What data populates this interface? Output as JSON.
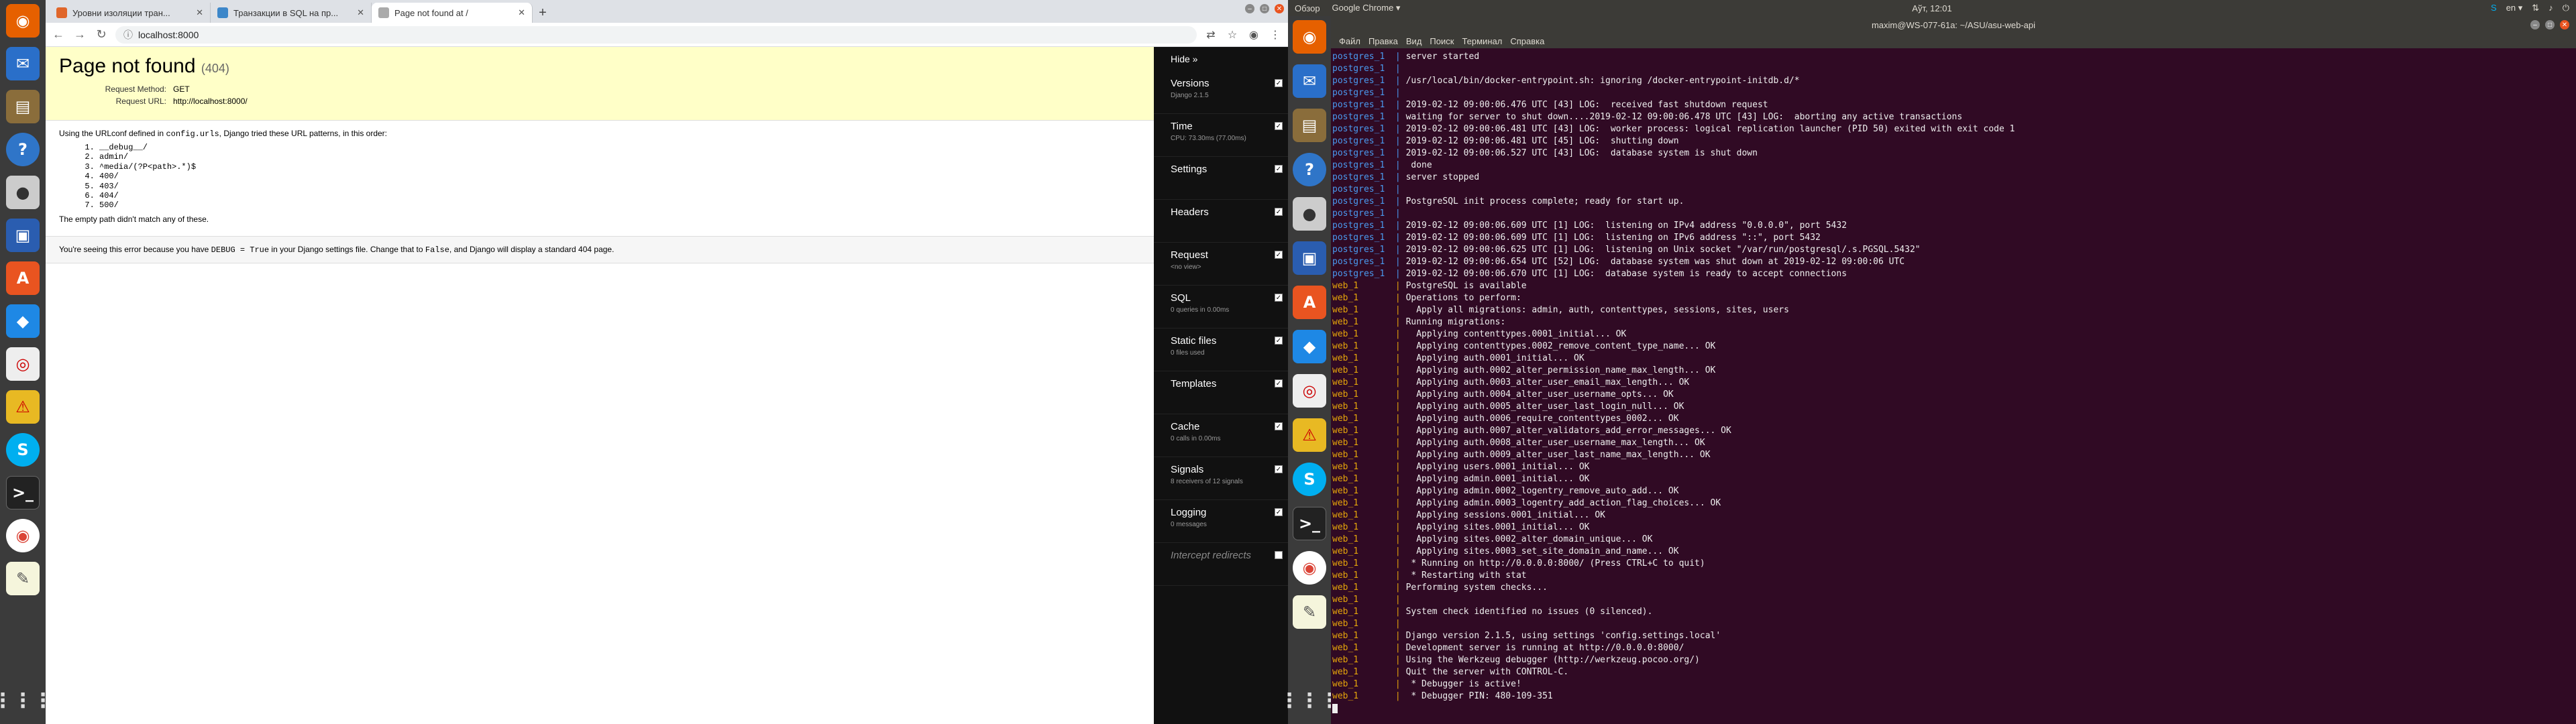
{
  "chrome": {
    "tabs": [
      {
        "label": "Уровни изоляции тран...",
        "active": false,
        "favicon_color": "#e0662a"
      },
      {
        "label": "Транзакции в SQL на пр...",
        "active": false,
        "favicon_color": "#3d87c9"
      },
      {
        "label": "Page not found at /",
        "active": true,
        "favicon_color": "#aaaaaa"
      }
    ],
    "new_tab_label": "+",
    "url": "localhost:8000"
  },
  "django": {
    "title": "Page not found",
    "code": "(404)",
    "meta": [
      {
        "key": "Request Method:",
        "value": "GET"
      },
      {
        "key": "Request URL:",
        "value": "http://localhost:8000/"
      }
    ],
    "info_lead_1": "Using the URLconf defined in ",
    "info_lead_code": "config.urls",
    "info_lead_2": ", Django tried these URL patterns, in this order:",
    "patterns": [
      "__debug__/",
      "admin/",
      "^media/(?P<path>.*)$",
      "400/",
      "403/",
      "404/",
      "500/"
    ],
    "info_tail": "The empty path didn't match any of these.",
    "explanation_1": "You're seeing this error because you have ",
    "explanation_code1": "DEBUG = True",
    "explanation_2": " in your Django settings file. Change that to ",
    "explanation_code2": "False",
    "explanation_3": ", and Django will display a standard 404 page."
  },
  "djdt": {
    "hide": "Hide »",
    "panels": [
      {
        "title": "Versions",
        "sub": "Django 2.1.5",
        "checked": true
      },
      {
        "title": "Time",
        "sub": "CPU: 73.30ms (77.00ms)",
        "checked": true
      },
      {
        "title": "Settings",
        "sub": "",
        "checked": true
      },
      {
        "title": "Headers",
        "sub": "",
        "checked": true
      },
      {
        "title": "Request",
        "sub": "<no view>",
        "checked": true
      },
      {
        "title": "SQL",
        "sub": "0 queries in 0.00ms",
        "checked": true
      },
      {
        "title": "Static files",
        "sub": "0 files used",
        "checked": true
      },
      {
        "title": "Templates",
        "sub": "",
        "checked": true
      },
      {
        "title": "Cache",
        "sub": "0 calls in 0.00ms",
        "checked": true
      },
      {
        "title": "Signals",
        "sub": "8 receivers of 12 signals",
        "checked": true
      },
      {
        "title": "Logging",
        "sub": "0 messages",
        "checked": true
      },
      {
        "title": "Intercept redirects",
        "sub": "",
        "checked": false
      }
    ]
  },
  "ubuntu": {
    "activities": "Обзор",
    "app_menu": "Google Chrome ▾",
    "clock": "Аўт, 12:01",
    "lang": "en ▾"
  },
  "terminal": {
    "title": "maxim@WS-077-61a: ~/ASU/asu-web-api",
    "menu": [
      "Файл",
      "Правка",
      "Вид",
      "Поиск",
      "Терминал",
      "Справка"
    ],
    "lines": [
      {
        "p": "postgres_1  | ",
        "t": "server started",
        "k": "pg"
      },
      {
        "p": "postgres_1  | ",
        "t": "",
        "k": "pg"
      },
      {
        "p": "postgres_1  | ",
        "t": "/usr/local/bin/docker-entrypoint.sh: ignoring /docker-entrypoint-initdb.d/*",
        "k": "pg"
      },
      {
        "p": "postgres_1  | ",
        "t": "",
        "k": "pg"
      },
      {
        "p": "postgres_1  | ",
        "t": "2019-02-12 09:00:06.476 UTC [43] LOG:  received fast shutdown request",
        "k": "pg"
      },
      {
        "p": "postgres_1  | ",
        "t": "waiting for server to shut down....2019-02-12 09:00:06.478 UTC [43] LOG:  aborting any active transactions",
        "k": "pg"
      },
      {
        "p": "postgres_1  | ",
        "t": "2019-02-12 09:00:06.481 UTC [43] LOG:  worker process: logical replication launcher (PID 50) exited with exit code 1",
        "k": "pg"
      },
      {
        "p": "postgres_1  | ",
        "t": "2019-02-12 09:00:06.481 UTC [45] LOG:  shutting down",
        "k": "pg"
      },
      {
        "p": "postgres_1  | ",
        "t": "2019-02-12 09:00:06.527 UTC [43] LOG:  database system is shut down",
        "k": "pg"
      },
      {
        "p": "postgres_1  | ",
        "t": " done",
        "k": "pg"
      },
      {
        "p": "postgres_1  | ",
        "t": "server stopped",
        "k": "pg"
      },
      {
        "p": "postgres_1  | ",
        "t": "",
        "k": "pg"
      },
      {
        "p": "postgres_1  | ",
        "t": "PostgreSQL init process complete; ready for start up.",
        "k": "pg"
      },
      {
        "p": "postgres_1  | ",
        "t": "",
        "k": "pg"
      },
      {
        "p": "postgres_1  | ",
        "t": "2019-02-12 09:00:06.609 UTC [1] LOG:  listening on IPv4 address \"0.0.0.0\", port 5432",
        "k": "pg"
      },
      {
        "p": "postgres_1  | ",
        "t": "2019-02-12 09:00:06.609 UTC [1] LOG:  listening on IPv6 address \"::\", port 5432",
        "k": "pg"
      },
      {
        "p": "postgres_1  | ",
        "t": "2019-02-12 09:00:06.625 UTC [1] LOG:  listening on Unix socket \"/var/run/postgresql/.s.PGSQL.5432\"",
        "k": "pg"
      },
      {
        "p": "postgres_1  | ",
        "t": "2019-02-12 09:00:06.654 UTC [52] LOG:  database system was shut down at 2019-02-12 09:00:06 UTC",
        "k": "pg"
      },
      {
        "p": "postgres_1  | ",
        "t": "2019-02-12 09:00:06.670 UTC [1] LOG:  database system is ready to accept connections",
        "k": "pg"
      },
      {
        "p": "web_1       | ",
        "t": "PostgreSQL is available",
        "k": "web"
      },
      {
        "p": "web_1       | ",
        "t": "Operations to perform:",
        "k": "web"
      },
      {
        "p": "web_1       | ",
        "t": "  Apply all migrations: admin, auth, contenttypes, sessions, sites, users",
        "k": "web"
      },
      {
        "p": "web_1       | ",
        "t": "Running migrations:",
        "k": "web"
      },
      {
        "p": "web_1       | ",
        "t": "  Applying contenttypes.0001_initial... OK",
        "k": "web"
      },
      {
        "p": "web_1       | ",
        "t": "  Applying contenttypes.0002_remove_content_type_name... OK",
        "k": "web"
      },
      {
        "p": "web_1       | ",
        "t": "  Applying auth.0001_initial... OK",
        "k": "web"
      },
      {
        "p": "web_1       | ",
        "t": "  Applying auth.0002_alter_permission_name_max_length... OK",
        "k": "web"
      },
      {
        "p": "web_1       | ",
        "t": "  Applying auth.0003_alter_user_email_max_length... OK",
        "k": "web"
      },
      {
        "p": "web_1       | ",
        "t": "  Applying auth.0004_alter_user_username_opts... OK",
        "k": "web"
      },
      {
        "p": "web_1       | ",
        "t": "  Applying auth.0005_alter_user_last_login_null... OK",
        "k": "web"
      },
      {
        "p": "web_1       | ",
        "t": "  Applying auth.0006_require_contenttypes_0002... OK",
        "k": "web"
      },
      {
        "p": "web_1       | ",
        "t": "  Applying auth.0007_alter_validators_add_error_messages... OK",
        "k": "web"
      },
      {
        "p": "web_1       | ",
        "t": "  Applying auth.0008_alter_user_username_max_length... OK",
        "k": "web"
      },
      {
        "p": "web_1       | ",
        "t": "  Applying auth.0009_alter_user_last_name_max_length... OK",
        "k": "web"
      },
      {
        "p": "web_1       | ",
        "t": "  Applying users.0001_initial... OK",
        "k": "web"
      },
      {
        "p": "web_1       | ",
        "t": "  Applying admin.0001_initial... OK",
        "k": "web"
      },
      {
        "p": "web_1       | ",
        "t": "  Applying admin.0002_logentry_remove_auto_add... OK",
        "k": "web"
      },
      {
        "p": "web_1       | ",
        "t": "  Applying admin.0003_logentry_add_action_flag_choices... OK",
        "k": "web"
      },
      {
        "p": "web_1       | ",
        "t": "  Applying sessions.0001_initial... OK",
        "k": "web"
      },
      {
        "p": "web_1       | ",
        "t": "  Applying sites.0001_initial... OK",
        "k": "web"
      },
      {
        "p": "web_1       | ",
        "t": "  Applying sites.0002_alter_domain_unique... OK",
        "k": "web"
      },
      {
        "p": "web_1       | ",
        "t": "  Applying sites.0003_set_site_domain_and_name... OK",
        "k": "web"
      },
      {
        "p": "web_1       | ",
        "t": " * Running on http://0.0.0.0:8000/ (Press CTRL+C to quit)",
        "k": "web"
      },
      {
        "p": "web_1       | ",
        "t": " * Restarting with stat",
        "k": "web"
      },
      {
        "p": "web_1       | ",
        "t": "Performing system checks...",
        "k": "web"
      },
      {
        "p": "web_1       | ",
        "t": "",
        "k": "web"
      },
      {
        "p": "web_1       | ",
        "t": "System check identified no issues (0 silenced).",
        "k": "web"
      },
      {
        "p": "web_1       | ",
        "t": "",
        "k": "web"
      },
      {
        "p": "web_1       | ",
        "t": "Django version 2.1.5, using settings 'config.settings.local'",
        "k": "web"
      },
      {
        "p": "web_1       | ",
        "t": "Development server is running at http://0.0.0.0:8000/",
        "k": "web"
      },
      {
        "p": "web_1       | ",
        "t": "Using the Werkzeug debugger (http://werkzeug.pocoo.org/)",
        "k": "web"
      },
      {
        "p": "web_1       | ",
        "t": "Quit the server with CONTROL-C.",
        "k": "web"
      },
      {
        "p": "web_1       | ",
        "t": " * Debugger is active!",
        "k": "web"
      },
      {
        "p": "web_1       | ",
        "t": " * Debugger PIN: 480-109-351",
        "k": "web"
      }
    ]
  }
}
